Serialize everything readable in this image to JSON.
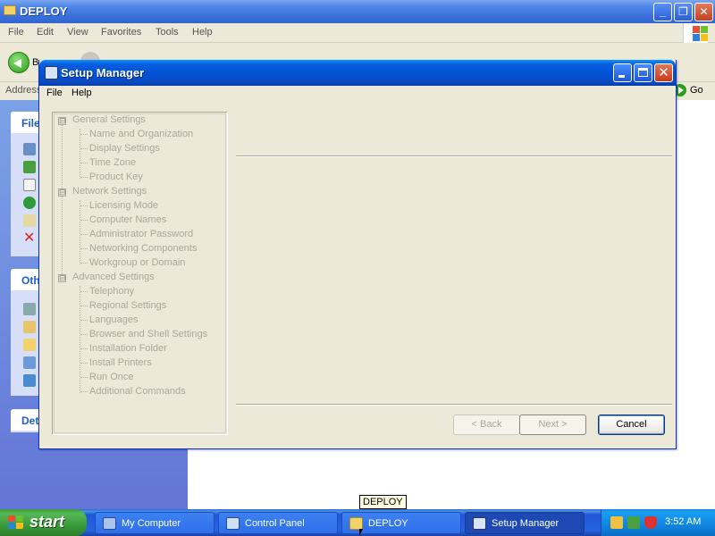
{
  "explorer": {
    "title": "DEPLOY",
    "menu": [
      "File",
      "Edit",
      "View",
      "Favorites",
      "Tools",
      "Help"
    ],
    "toolbar": {
      "back_label": "Back"
    },
    "address_label": "Address",
    "go_label": "Go",
    "task_panel_headers": [
      "File",
      "Oth",
      "Det"
    ]
  },
  "dialog": {
    "title": "Setup Manager",
    "menu": [
      "File",
      "Help"
    ],
    "tree": [
      {
        "label": "General Settings",
        "expander": "⊟",
        "children": [
          "Name and Organization",
          "Display Settings",
          "Time Zone",
          "Product Key"
        ]
      },
      {
        "label": "Network Settings",
        "expander": "⊟",
        "children": [
          "Licensing Mode",
          "Computer Names",
          "Administrator Password",
          "Networking Components",
          "Workgroup or Domain"
        ]
      },
      {
        "label": "Advanced Settings",
        "expander": "⊟",
        "children": [
          "Telephony",
          "Regional Settings",
          "Languages",
          "Browser and Shell Settings",
          "Installation Folder",
          "Install Printers",
          "Run Once",
          "Additional Commands"
        ]
      }
    ],
    "buttons": {
      "back": "< Back",
      "next": "Next >",
      "cancel": "Cancel"
    },
    "button_state": {
      "back_enabled": false,
      "next_enabled": false,
      "cancel_enabled": true
    }
  },
  "tooltip": "DEPLOY",
  "taskbar": {
    "start_label": "start",
    "tasks": [
      {
        "label": "My Computer",
        "icon": "computer-icon",
        "active": false
      },
      {
        "label": "Control Panel",
        "icon": "control-panel-icon",
        "active": false
      },
      {
        "label": "DEPLOY",
        "icon": "folder-icon",
        "active": false
      },
      {
        "label": "Setup Manager",
        "icon": "setup-manager-icon",
        "active": true
      }
    ],
    "clock": "3:52 AM"
  },
  "colors": {
    "title_blue": "#0053d6",
    "start_green": "#3a9b3a",
    "disabled_text": "#a9a79e",
    "dialog_face": "#ece9d8"
  }
}
